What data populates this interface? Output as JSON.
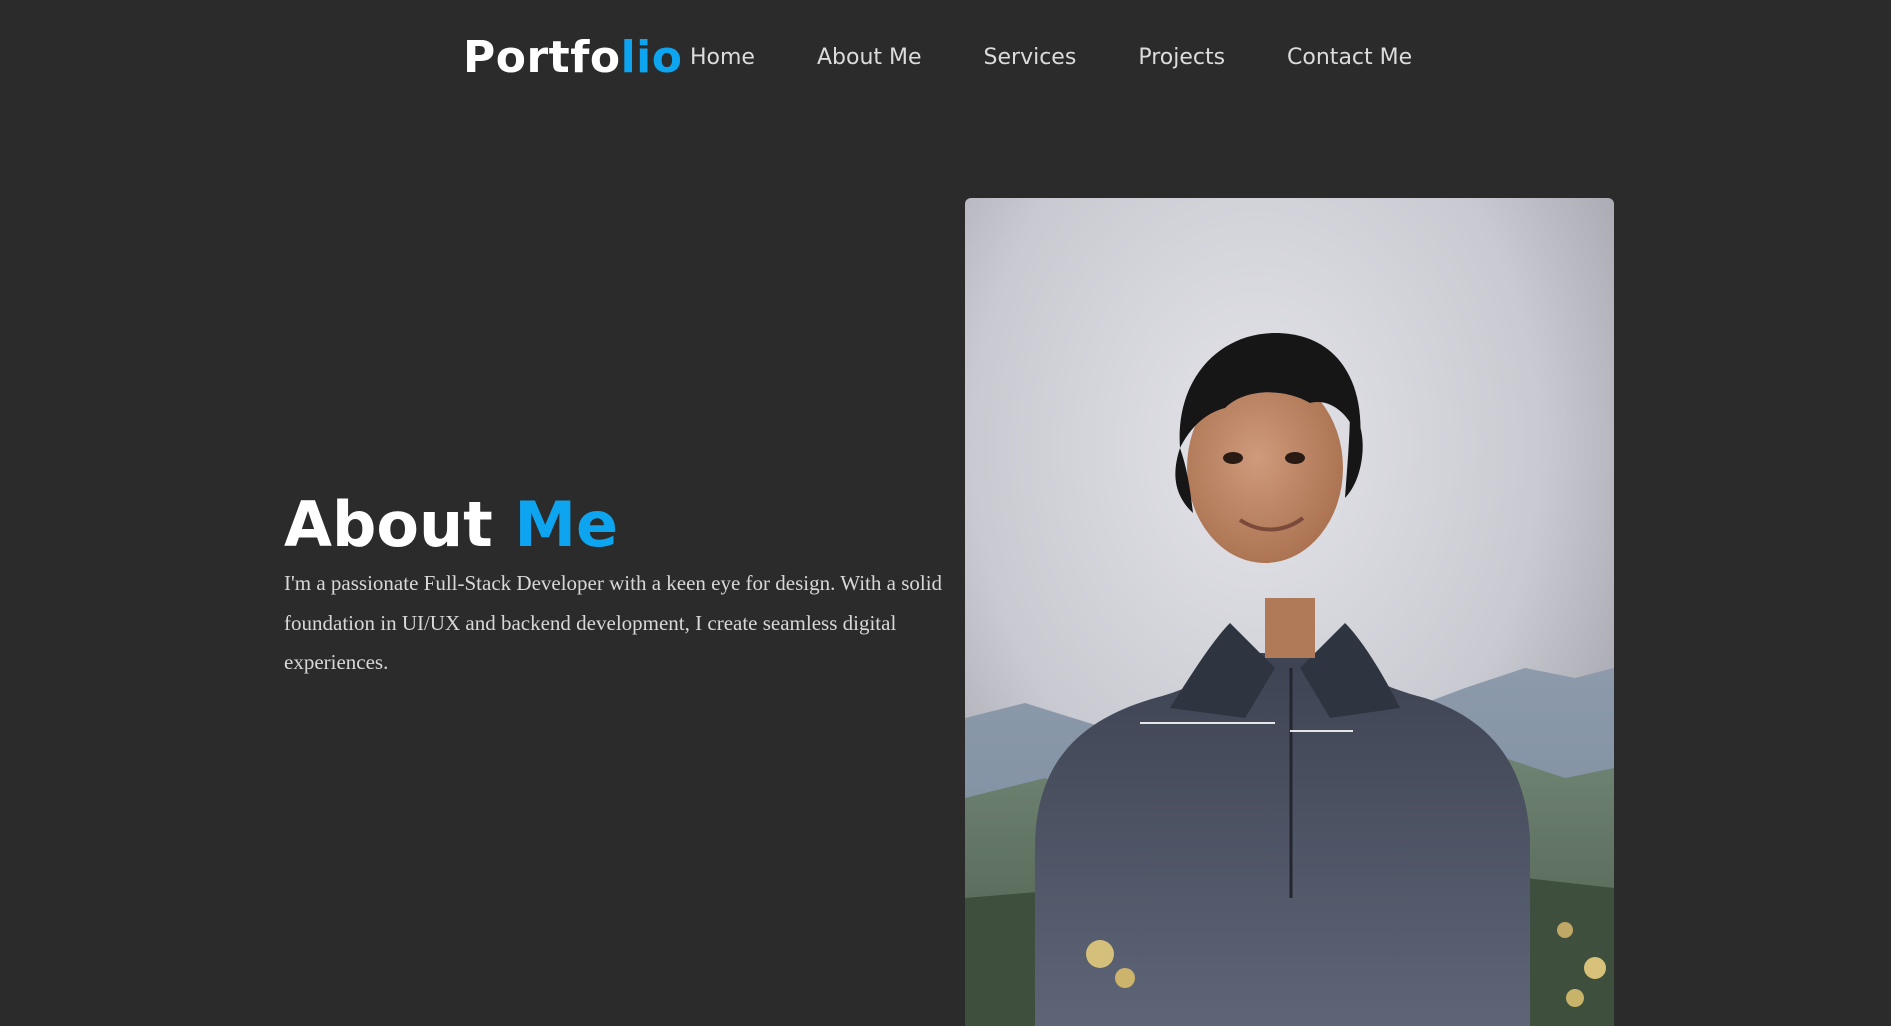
{
  "logo": {
    "main": "Portfo",
    "accent": "lio"
  },
  "nav": {
    "items": [
      {
        "label": "Home"
      },
      {
        "label": "About Me"
      },
      {
        "label": "Services"
      },
      {
        "label": "Projects"
      },
      {
        "label": "Contact Me"
      }
    ]
  },
  "about": {
    "title_main": "About",
    "title_accent": "Me",
    "description": "I'm a passionate Full-Stack Developer with a keen eye for design. With a solid foundation in UI/UX and backend development, I create seamless digital experiences."
  },
  "colors": {
    "background": "#2b2b2b",
    "accent": "#0ea5f0",
    "text": "#ffffff",
    "nav_text": "#dcdcdc"
  }
}
